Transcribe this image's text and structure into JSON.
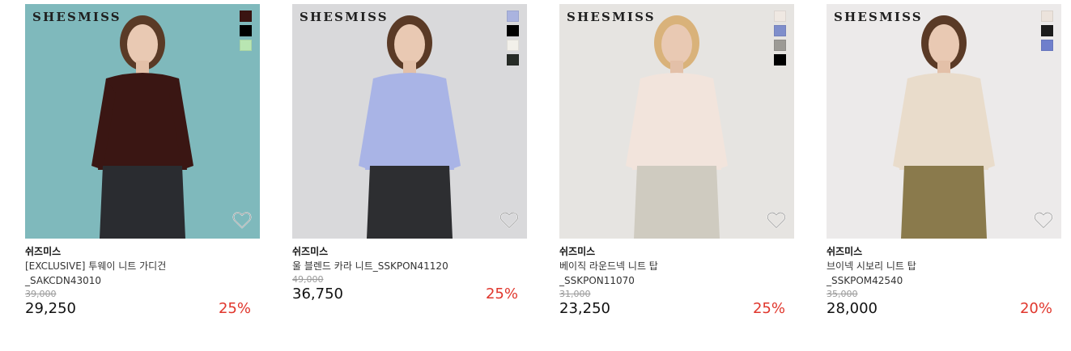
{
  "products": [
    {
      "logo": "SHESMISS",
      "brand": "쉬즈미스",
      "name": "[EXCLUSIVE] 투웨이 니트 가디건_SAKCDN43010",
      "original_price": "39,000",
      "sale_price": "29,250",
      "discount": "25%",
      "swatches": [
        "#3a1411",
        "#000000",
        "#b9e6b2"
      ],
      "image_bg": "#7fb9bc",
      "garment_color": "#3a1613",
      "bottom_color": "#2a2c30",
      "wish_icon": "heart-outline-icon"
    },
    {
      "logo": "SHESMISS",
      "brand": "쉬즈미스",
      "name": "울 블렌드 카라 니트_SSKPON41120",
      "original_price": "49,000",
      "sale_price": "36,750",
      "discount": "25%",
      "swatches": [
        "#aab3df",
        "#000000",
        "#f2f0ea",
        "#262b26"
      ],
      "image_bg": "#d9d9db",
      "garment_color": "#a9b4e6",
      "bottom_color": "#2d2e31",
      "wish_icon": "heart-outline-icon"
    },
    {
      "logo": "SHESMISS",
      "brand": "쉬즈미스",
      "name": "베이직 라운드넥 니트 탑_SSKPON11070",
      "original_price": "31,000",
      "sale_price": "23,250",
      "discount": "25%",
      "swatches": [
        "#efe8e2",
        "#7f8ecb",
        "#9c9a95",
        "#000000"
      ],
      "image_bg": "#e6e4e1",
      "garment_color": "#f2e4dc",
      "bottom_color": "#cfcbc0",
      "wish_icon": "heart-outline-icon"
    },
    {
      "logo": "SHESMISS",
      "brand": "쉬즈미스",
      "name": "브이넥 시보리 니트 탑_SSKPOM42540",
      "original_price": "35,000",
      "sale_price": "28,000",
      "discount": "20%",
      "swatches": [
        "#ece3dc",
        "#1c1c1c",
        "#6f7fcc"
      ],
      "image_bg": "#eceaea",
      "garment_color": "#e9dccb",
      "bottom_color": "#8a7a4c",
      "wish_icon": "heart-outline-icon"
    }
  ]
}
